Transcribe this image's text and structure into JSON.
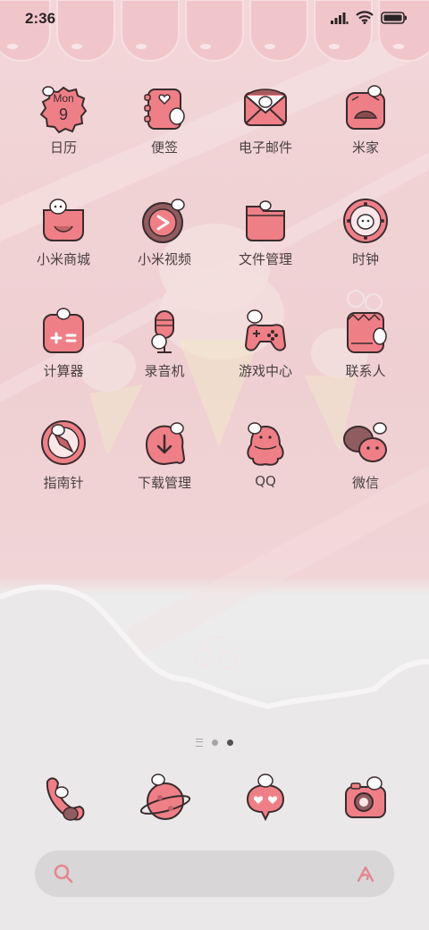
{
  "status_bar": {
    "time": "2:36"
  },
  "apps": [
    {
      "label": "日历",
      "icon": "calendar-icon",
      "calendar_day": "Mon",
      "calendar_date": "9"
    },
    {
      "label": "便签",
      "icon": "notes-icon"
    },
    {
      "label": "电子邮件",
      "icon": "email-icon"
    },
    {
      "label": "米家",
      "icon": "mi-home-icon"
    },
    {
      "label": "小米商城",
      "icon": "mi-store-icon"
    },
    {
      "label": "小米视频",
      "icon": "mi-video-icon"
    },
    {
      "label": "文件管理",
      "icon": "file-manager-icon"
    },
    {
      "label": "时钟",
      "icon": "clock-icon"
    },
    {
      "label": "计算器",
      "icon": "calculator-icon"
    },
    {
      "label": "录音机",
      "icon": "recorder-icon"
    },
    {
      "label": "游戏中心",
      "icon": "game-center-icon"
    },
    {
      "label": "联系人",
      "icon": "contacts-icon"
    },
    {
      "label": "指南针",
      "icon": "compass-icon"
    },
    {
      "label": "下载管理",
      "icon": "download-manager-icon"
    },
    {
      "label": "QQ",
      "icon": "qq-icon"
    },
    {
      "label": "微信",
      "icon": "wechat-icon"
    }
  ],
  "pager": {
    "pages": 2,
    "active": 2
  },
  "dock": [
    {
      "icon": "phone-icon"
    },
    {
      "icon": "browser-planet-icon"
    },
    {
      "icon": "messages-icon"
    },
    {
      "icon": "camera-icon"
    }
  ],
  "search_bar": {
    "search_icon": "search-icon",
    "assistant_icon": "assistant-icon"
  },
  "colors": {
    "icon_pink": "#ef7f87",
    "icon_outline": "#3a2b2d",
    "label": "#4a3f42",
    "dot_active": "#555052"
  }
}
